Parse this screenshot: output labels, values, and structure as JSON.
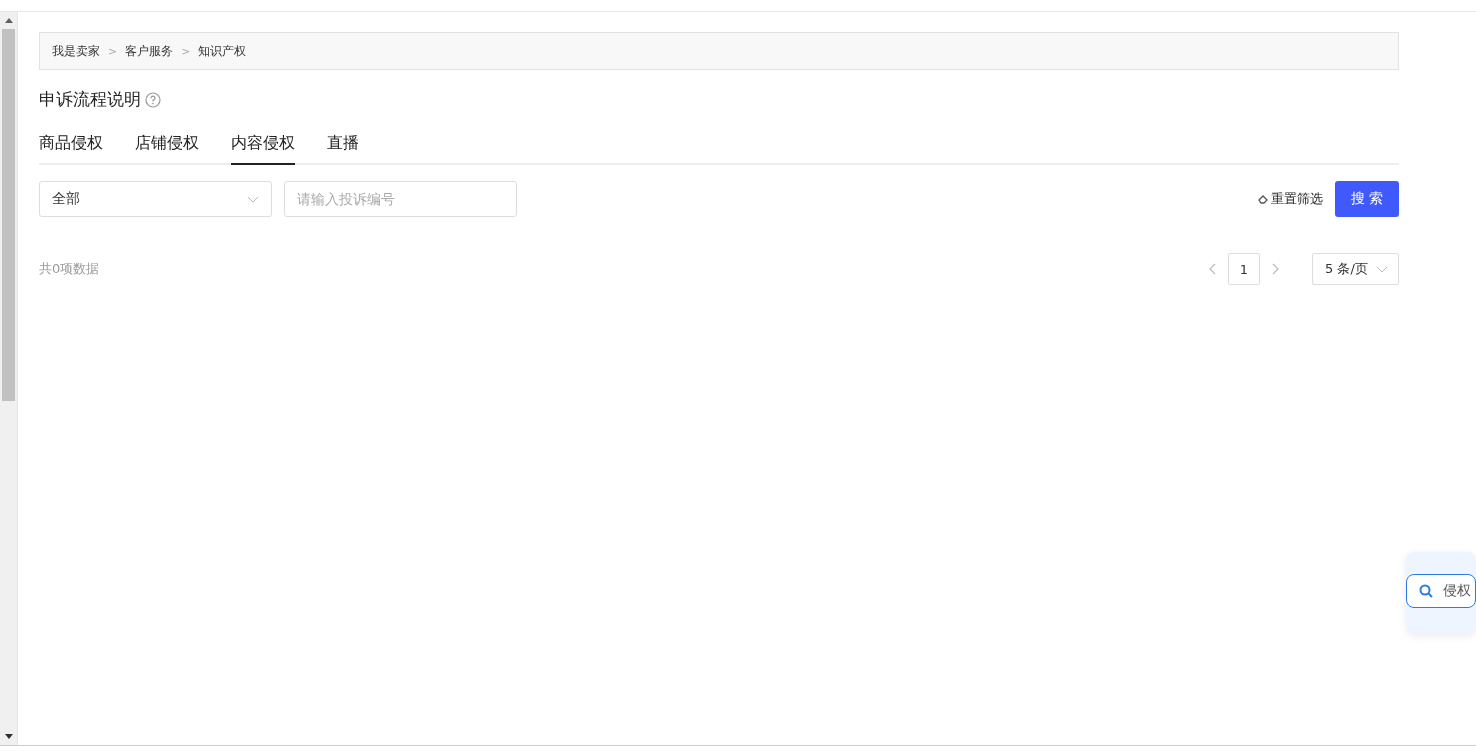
{
  "breadcrumb": [
    {
      "label": "我是卖家"
    },
    {
      "label": "客户服务"
    },
    {
      "label": "知识产权"
    }
  ],
  "breadcrumb_separator": ">",
  "title": "申诉流程说明",
  "tabs": [
    {
      "label": "商品侵权",
      "selected": false
    },
    {
      "label": "店铺侵权",
      "selected": false
    },
    {
      "label": "内容侵权",
      "selected": true
    },
    {
      "label": "直播",
      "selected": false
    }
  ],
  "filters": {
    "type_select": {
      "value": "全部"
    },
    "complaint_no": {
      "placeholder": "请输入投诉编号"
    },
    "reset": "重置筛选",
    "search_button": "搜 索"
  },
  "total": "共0项数据",
  "pagination": {
    "current_page": "1",
    "page_size": "5 条/页"
  },
  "floating_widget": {
    "search_text": "侵权"
  }
}
